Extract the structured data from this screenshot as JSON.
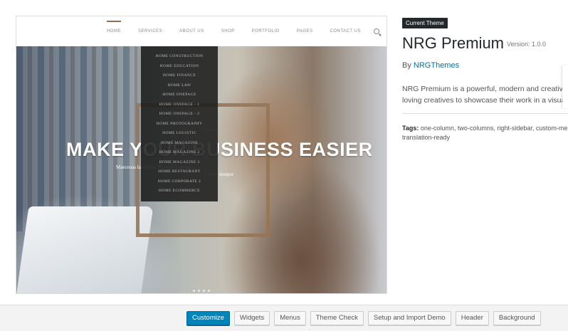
{
  "screenshot": {
    "nav": [
      "Home",
      "Services",
      "About Us",
      "Shop",
      "Portfolio",
      "Pages",
      "Contact Us"
    ],
    "dropdown": [
      "Home Construction",
      "Home Education",
      "Home Finance",
      "Home Law",
      "Home Onepage",
      "Home Onepage - 1",
      "Home Onepage - 2",
      "Home Photography",
      "Home Logistic",
      "Home Magazine",
      "Home Magazine 2",
      "Home Magazine 3",
      "Home Restaurant",
      "Home Corporate 2",
      "Home eCommerce"
    ],
    "hero_title": "MAKE YOUR BUSINESS EASIER",
    "hero_kicker": "business",
    "hero_sub": "Maecenas lacinia ut. Phasellus dapibus",
    "hero_sub2": "nunc tempor"
  },
  "info": {
    "badge": "Current Theme",
    "name": "NRG Premium",
    "version": "Version: 1.0.0",
    "by_label": "By",
    "author": "NRGThemes",
    "desc_line1": "NRG Premium is a powerful, modern and creative W",
    "desc_line2": "loving creatives to showcase their work in a visually",
    "tags_label": "Tags:",
    "tags_line1": "one-column, two-columns, right-sidebar, custom-me",
    "tags_line2": "translation-ready"
  },
  "footer": {
    "buttons": [
      "Customize",
      "Widgets",
      "Menus",
      "Theme Check",
      "Setup and Import Demo",
      "Header",
      "Background"
    ]
  },
  "colors": {
    "primary": "#0085ba",
    "link": "#0073aa",
    "badge_bg": "#23282d",
    "accent_brown": "#8a7055"
  }
}
